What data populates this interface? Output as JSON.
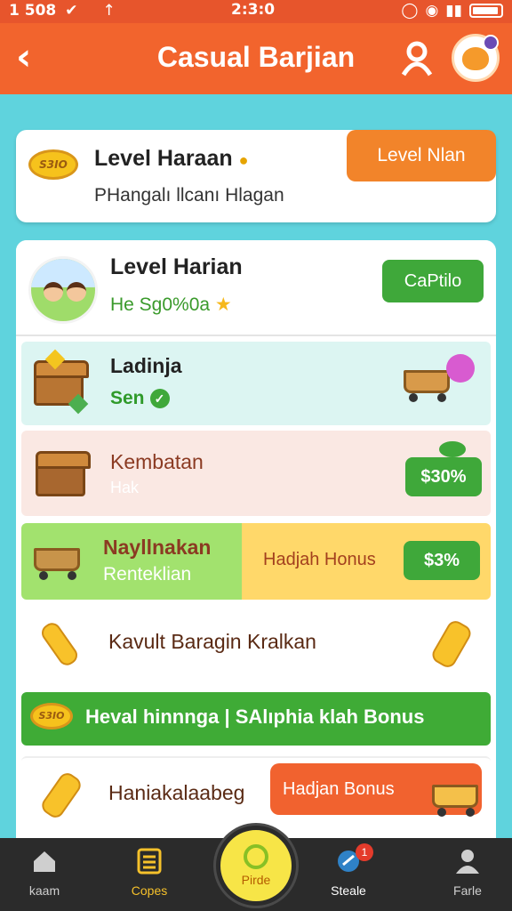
{
  "status_bar": {
    "left_text": "1 508",
    "time": "2:3:0"
  },
  "header": {
    "title": "Casual Barjian",
    "back_icon": "chevron-left-icon",
    "user_icon": "user-icon"
  },
  "card1": {
    "badge": "S3IO",
    "title": "Level Haraan",
    "subtitle": "PHangalı llcanı Hlagan",
    "button": "Level Nlan"
  },
  "panel": {
    "top": {
      "title": "Level Harian",
      "subtitle": "He Sg0%0a",
      "button": "CaPtilo"
    },
    "rows": [
      {
        "title": "Ladinja",
        "subtitle": "Sen"
      },
      {
        "title": "Kembatan",
        "subtitle": "Hak",
        "price": "$30%"
      },
      {
        "title": "Nayllnakan",
        "subtitle": "Renteklian",
        "right_text": "Hadjah Honus",
        "price": "$3%"
      },
      {
        "title": "Kavult Baragin Kralkan"
      },
      {
        "badge": "S3IO",
        "text": "Heval hinnnga | SAlıphia klah Bonus"
      },
      {
        "title": "Haniakalaabeg",
        "button": "Hadjan Bonus"
      }
    ]
  },
  "nav": {
    "items": [
      {
        "label": "kaam",
        "icon": "home-icon"
      },
      {
        "label": "Copes",
        "icon": "list-icon"
      },
      {
        "label": "Pirde",
        "icon": "circle-icon"
      },
      {
        "label": "Steale",
        "icon": "gamepad-icon",
        "badge": "1"
      },
      {
        "label": "Farle",
        "icon": "user-icon"
      }
    ]
  },
  "colors": {
    "header": "#f2642d",
    "background": "#5fd3dd",
    "green": "#3fa83a",
    "orange": "#f2842a"
  }
}
